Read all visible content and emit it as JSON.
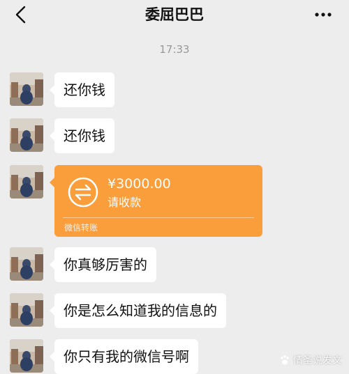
{
  "header": {
    "title": "委屈巴巴",
    "back_icon": "chevron-left-icon",
    "more_icon": "more-horizontal-icon"
  },
  "timestamp": "17:33",
  "messages": [
    {
      "type": "text",
      "text": "还你钱"
    },
    {
      "type": "text",
      "text": "还你钱"
    },
    {
      "type": "transfer",
      "amount": "¥3000.00",
      "status": "请收款",
      "footer": "微信转账",
      "color": "#fa9d3b"
    },
    {
      "type": "text",
      "text": "你真够厉害的"
    },
    {
      "type": "text",
      "text": "你是怎么知道我的信息的"
    },
    {
      "type": "text",
      "text": "你只有我的微信号啊"
    }
  ],
  "watermark": {
    "text": "情圣说发文",
    "icon": "paw-icon"
  },
  "colors": {
    "background": "#ededed",
    "bubble": "#ffffff",
    "transfer": "#fa9d3b",
    "timestamp": "#999999"
  }
}
